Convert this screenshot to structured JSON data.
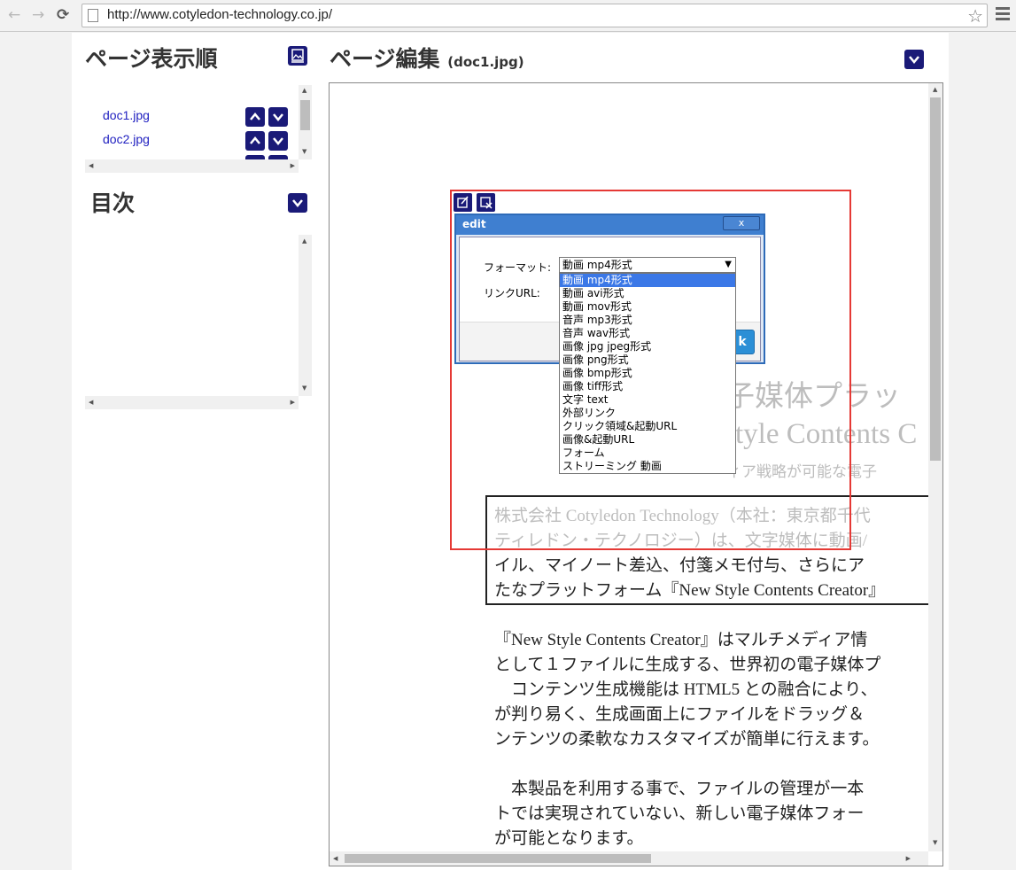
{
  "browser": {
    "url": "http://www.cotyledon-technology.co.jp/"
  },
  "sidebar": {
    "page_order_title": "ページ表示順",
    "pages": [
      {
        "name": "doc1.jpg"
      },
      {
        "name": "doc2.jpg"
      }
    ],
    "toc_title": "目次"
  },
  "editor": {
    "title": "ページ編集",
    "current_file": "(doc1.jpg)"
  },
  "document": {
    "bg_line1": "子媒体プラッ",
    "bg_line2": "tyle Contents C",
    "bg_line3": "ィア戦略が可能な電子",
    "box_line1": "株式会社 Cotyledon Technology（本社：東京都千代",
    "box_line2": "ティレドン・テクノロジー）は、文字媒体に動画/",
    "box_line3": "イル、マイノート差込、付箋メモ付与、さらにア",
    "box_line4": "たなプラットフォーム『New Style Contents Creator』",
    "para1_line1": "『New Style Contents Creator』はマルチメディア情",
    "para1_line2": "として１ファイルに生成する、世界初の電子媒体プ",
    "para1_line3": "　コンテンツ生成機能は HTML5 との融合により、",
    "para1_line4": "が判り易く、生成画面上にファイルをドラッグ＆",
    "para1_line5": "ンテンツの柔軟なカスタマイズが簡単に行えます。",
    "para2_line1": "　本製品を利用する事で、ファイルの管理が一本",
    "para2_line2": "トでは実現されていない、新しい電子媒体フォー",
    "para2_line3": "が可能となります。"
  },
  "dialog": {
    "title": "edit",
    "close_label": "x",
    "format_label": "フォーマット:",
    "link_label": "リンクURL:",
    "ok_label": "k",
    "selected_format": "動画  mp4形式",
    "options": [
      "動画  mp4形式",
      "動画  avi形式",
      "動画  mov形式",
      "音声  mp3形式",
      "音声  wav形式",
      "画像  jpg jpeg形式",
      "画像  png形式",
      "画像  bmp形式",
      "画像  tiff形式",
      "文字  text",
      "外部リンク",
      "クリック領域&起動URL",
      "画像&起動URL",
      "フォーム",
      "ストリーミング 動画"
    ]
  },
  "colors": {
    "nav_button": "#1a1a78",
    "dialog_title": "#3f7fd0",
    "selection": "#3b78e7",
    "highlight_box": "#e53935"
  }
}
